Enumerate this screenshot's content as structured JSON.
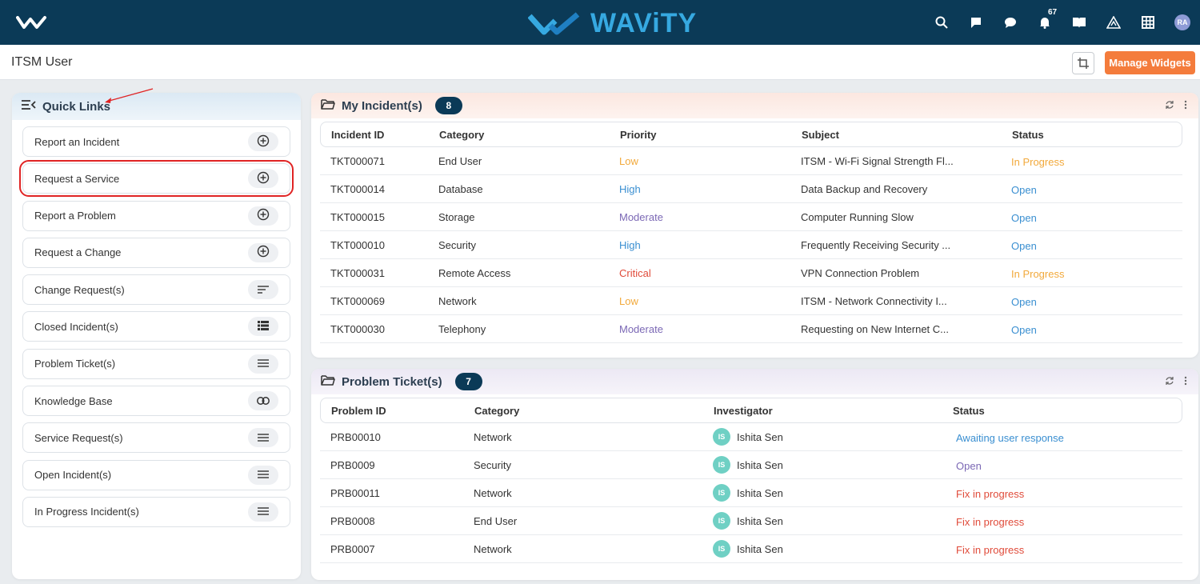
{
  "app": {
    "brand": "WAViTY",
    "notification_count": "67",
    "user_initials": "RA"
  },
  "colors": {
    "topbar": "#0b3a57",
    "accent": "#36a9e1",
    "manage_button": "#f47c3c",
    "highlight": "#e02424"
  },
  "header": {
    "page_title": "ITSM User",
    "manage_widgets_label": "Manage Widgets"
  },
  "top_icons": [
    "search-icon",
    "chat-icon",
    "message-icon",
    "bell-icon",
    "book-icon",
    "warning-icon",
    "grid-icon",
    "avatar"
  ],
  "quick_links": {
    "title": "Quick Links",
    "items": [
      {
        "label": "Report an Incident",
        "icon": "plus-circle-icon"
      },
      {
        "label": "Request a Service",
        "icon": "plus-circle-icon"
      },
      {
        "label": "Report a Problem",
        "icon": "plus-circle-icon"
      },
      {
        "label": "Request a Change",
        "icon": "plus-circle-icon"
      },
      {
        "label": "Change Request(s)",
        "icon": "sort-icon"
      },
      {
        "label": "Closed Incident(s)",
        "icon": "list-icon"
      },
      {
        "label": "Problem Ticket(s)",
        "icon": "menu-icon"
      },
      {
        "label": "Knowledge Base",
        "icon": "link-icon"
      },
      {
        "label": "Service Request(s)",
        "icon": "menu-icon"
      },
      {
        "label": "Open Incident(s)",
        "icon": "menu-icon"
      },
      {
        "label": "In Progress Incident(s)",
        "icon": "menu-icon"
      }
    ]
  },
  "incidents": {
    "title": "My Incident(s)",
    "count": "8",
    "columns": [
      "Incident ID",
      "Category",
      "Priority",
      "Subject",
      "Status"
    ],
    "rows": [
      {
        "id": "TKT000071",
        "category": "End User",
        "priority": "Low",
        "subject": "ITSM - Wi-Fi Signal Strength Fl...",
        "status": "In Progress"
      },
      {
        "id": "TKT000014",
        "category": "Database",
        "priority": "High",
        "subject": "Data Backup and Recovery",
        "status": "Open"
      },
      {
        "id": "TKT000015",
        "category": "Storage",
        "priority": "Moderate",
        "subject": "Computer Running Slow",
        "status": "Open"
      },
      {
        "id": "TKT000010",
        "category": "Security",
        "priority": "High",
        "subject": "Frequently Receiving Security ...",
        "status": "Open"
      },
      {
        "id": "TKT000031",
        "category": "Remote Access",
        "priority": "Critical",
        "subject": "VPN Connection Problem",
        "status": "In Progress"
      },
      {
        "id": "TKT000069",
        "category": "Network",
        "priority": "Low",
        "subject": "ITSM - Network Connectivity I...",
        "status": "Open"
      },
      {
        "id": "TKT000030",
        "category": "Telephony",
        "priority": "Moderate",
        "subject": "Requesting on New Internet C...",
        "status": "Open"
      }
    ]
  },
  "problems": {
    "title": "Problem Ticket(s)",
    "count": "7",
    "columns": [
      "Problem ID",
      "Category",
      "Investigator",
      "Status"
    ],
    "rows": [
      {
        "id": "PRB00010",
        "category": "Network",
        "initials": "IS",
        "investigator": "Ishita Sen",
        "status": "Awaiting user response"
      },
      {
        "id": "PRB0009",
        "category": "Security",
        "initials": "IS",
        "investigator": "Ishita Sen",
        "status": "Open"
      },
      {
        "id": "PRB00011",
        "category": "Network",
        "initials": "IS",
        "investigator": "Ishita Sen",
        "status": "Fix in progress"
      },
      {
        "id": "PRB0008",
        "category": "End User",
        "initials": "IS",
        "investigator": "Ishita Sen",
        "status": "Fix in progress"
      },
      {
        "id": "PRB0007",
        "category": "Network",
        "initials": "IS",
        "investigator": "Ishita Sen",
        "status": "Fix in progress"
      }
    ]
  }
}
